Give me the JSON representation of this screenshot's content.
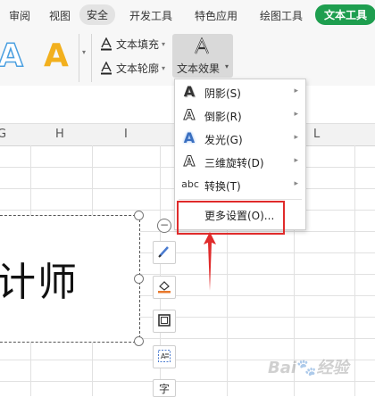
{
  "menu_tabs": [
    "审阅",
    "视图",
    "安全",
    "开发工具",
    "特色应用",
    "绘图工具",
    "文本工具"
  ],
  "ribbon": {
    "style_samples": [
      "A",
      "A"
    ],
    "text_fill_label": "文本填充",
    "text_outline_label": "文本轮廓",
    "text_effect_label": "文本效果",
    "accent_color": "#1e9e4f",
    "sample_colors": [
      "#4a9fe0",
      "#f2b01e"
    ]
  },
  "sheet": {
    "columns": [
      "G",
      "H",
      "I",
      "",
      "L"
    ],
    "textbox_text": "计师"
  },
  "dropdown": {
    "items": [
      {
        "label": "阴影(S)",
        "icon": "shadow-A-icon"
      },
      {
        "label": "倒影(R)",
        "icon": "reflection-A-icon"
      },
      {
        "label": "发光(G)",
        "icon": "glow-A-icon"
      },
      {
        "label": "三维旋转(D)",
        "icon": "3d-rotate-A-icon"
      },
      {
        "label": "转换(T)",
        "icon": "transform-abc-icon",
        "icon_text": "abc"
      }
    ],
    "more_settings": "更多设置(O)..."
  },
  "annotation_color": "#e02b2b"
}
